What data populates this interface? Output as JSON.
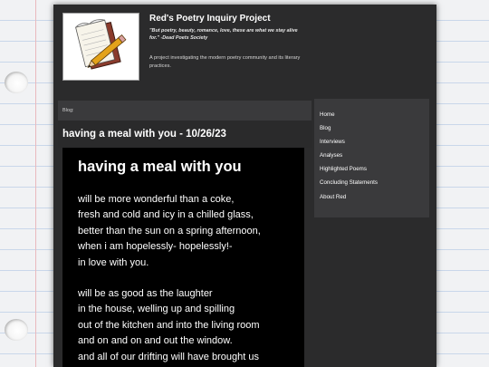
{
  "site": {
    "title": "Red's Poetry Inquiry Project",
    "tagline": "\"But poetry, beauty, romance, love, these are what we stay alive for.\" -Dead Poets Society",
    "description": "A project investigating the modern poetry community and its literary practices."
  },
  "breadcrumb": "Blog:",
  "post": {
    "title": "having a meal with you - 10/26/23",
    "poem_title": "having a meal with you",
    "stanza1": [
      "will be more wonderful than a coke,",
      "fresh and cold and icy in a chilled glass,",
      "better than the sun on a spring afternoon,",
      "when i am hopelessly- hopelessly!-",
      "in love with you."
    ],
    "stanza2": [
      "will be as good as the laughter",
      "in the house, welling up and spilling",
      "out of the kitchen and into the living room",
      "and on and on and out the window.",
      "and all of our drifting will have brought us"
    ]
  },
  "nav": {
    "items": [
      "Home",
      "Blog",
      "Interviews",
      "Analyses",
      "Highlighted Poems",
      "Concluding Statements",
      "About Red"
    ]
  },
  "logo_icon": "notepad-and-pencil-icon",
  "colors": {
    "page_bg": "#2b2b2c",
    "panel_bg": "#3a3a3c",
    "poem_bg": "#000000",
    "text": "#ffffff"
  }
}
